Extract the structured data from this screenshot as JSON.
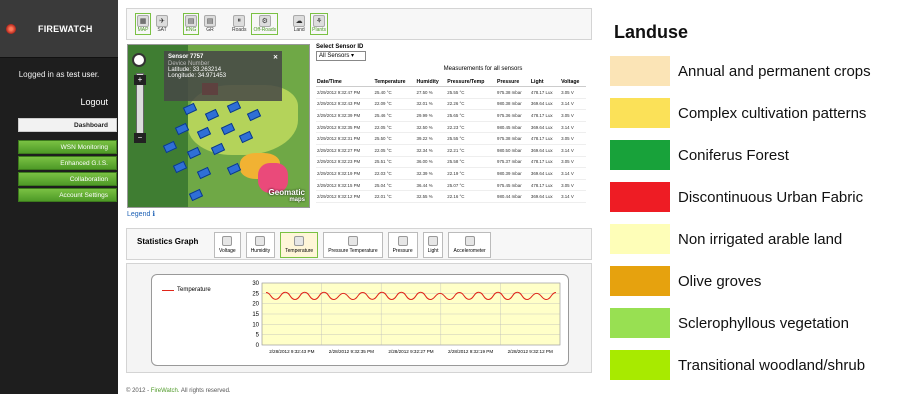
{
  "sidebar": {
    "brand": "FIREWATCH",
    "logged_in_prefix": "Logged in as",
    "logged_in_user": "test user.",
    "logout": "Logout",
    "menu": [
      "Dashboard",
      "WSN Monitoring",
      "Enhanced G.I.S.",
      "Collaboration",
      "Account Settings"
    ]
  },
  "toolbar": {
    "groups": [
      {
        "items": [
          "MAP",
          "SAT"
        ]
      },
      {
        "items": [
          "ENG",
          "GR"
        ]
      },
      {
        "items": [
          "Roads",
          "Off-Roads"
        ]
      },
      {
        "items": [
          "Land",
          "Plants"
        ]
      }
    ]
  },
  "map": {
    "popup_title": "Sensor 7757",
    "popup_sub": "Device Number",
    "popup_lat": "Latitude: 33.263214",
    "popup_lon": "Longitude: 34.971453",
    "watermark": "Geomatic",
    "watermark_sub": "maps"
  },
  "legend_link": "Legend",
  "sensor_select": {
    "label": "Select Sensor ID",
    "value": "All Sensors"
  },
  "measurements": {
    "title": "Measurements for all sensors",
    "columns": [
      "Date/Time",
      "Temperature",
      "Humidity",
      "Pressure/Temp",
      "Pressure",
      "Light",
      "Voltage"
    ],
    "rows": [
      [
        "2/29/2012 9:32:47 PM",
        "25.40 °C",
        "27.50 %",
        "25.55 °C",
        "975.38 mbar",
        "478.17 Lux",
        "3.05 V"
      ],
      [
        "2/29/2012 9:32:43 PM",
        "22.09 °C",
        "32.01 %",
        "22.26 °C",
        "980.38 mbar",
        "369.64 Lux",
        "3.14 V"
      ],
      [
        "2/29/2012 9:32:39 PM",
        "25.46 °C",
        "29.99 %",
        "25.65 °C",
        "975.36 mbar",
        "478.17 Lux",
        "3.05 V"
      ],
      [
        "2/29/2012 9:32:35 PM",
        "22.05 °C",
        "32.50 %",
        "22.23 °C",
        "980.45 mbar",
        "369.64 Lux",
        "3.14 V"
      ],
      [
        "2/29/2012 9:32:31 PM",
        "25.50 °C",
        "39.22 %",
        "25.55 °C",
        "975.38 mbar",
        "478.17 Lux",
        "3.05 V"
      ],
      [
        "2/29/2012 9:32:27 PM",
        "22.05 °C",
        "32.34 %",
        "22.21 °C",
        "980.50 mbar",
        "369.64 Lux",
        "3.14 V"
      ],
      [
        "2/29/2012 9:32:23 PM",
        "25.51 °C",
        "36.00 %",
        "25.58 °C",
        "975.37 mbar",
        "478.17 Lux",
        "3.05 V"
      ],
      [
        "2/29/2012 9:32:19 PM",
        "22.03 °C",
        "32.39 %",
        "22.19 °C",
        "980.39 mbar",
        "369.64 Lux",
        "3.14 V"
      ],
      [
        "2/29/2012 9:32:15 PM",
        "25.04 °C",
        "36.44 %",
        "25.07 °C",
        "975.45 mbar",
        "478.17 Lux",
        "3.05 V"
      ],
      [
        "2/29/2012 9:32:12 PM",
        "22.01 °C",
        "32.55 %",
        "22.16 °C",
        "980.44 mbar",
        "369.64 Lux",
        "3.14 V"
      ]
    ]
  },
  "stats": {
    "title": "Statistics Graph",
    "buttons": [
      "Voltage",
      "Humidity",
      "Temperature",
      "Pressure Temperature",
      "Pressure",
      "Light",
      "Accelerometer"
    ],
    "active": "Temperature"
  },
  "chart_data": {
    "type": "line",
    "series": [
      {
        "name": "Temperature",
        "values": [
          25.4,
          22.1,
          25.5,
          22.0,
          25.5,
          22.0,
          25.5,
          22.0,
          25.0,
          22.0,
          25.4,
          22.1,
          25.5,
          22.0,
          25.5,
          22.0,
          25.5,
          22.0,
          25.0,
          22.0,
          25.4,
          22.1,
          25.5,
          22.0,
          25.5,
          22.0,
          25.5,
          22.0,
          25.0,
          22.0,
          25.4
        ]
      }
    ],
    "yticks": [
      0,
      5,
      10,
      15,
      20,
      25,
      30
    ],
    "ylim": [
      0,
      30
    ],
    "xticklabels": [
      "2/28/2012 9:32:43 PM",
      "2/28/2012 9:32:35 PM",
      "2/28/2012 9:32:27 PM",
      "2/28/2012 9:32:19 PM",
      "2/28/2012 9:32:12 PM"
    ],
    "colors": {
      "line": "#e0261a",
      "fill": "#ffffc8"
    }
  },
  "footer": {
    "prefix": "© 2012 -",
    "link": "FireWatch.",
    "suffix": "All rights reserved."
  },
  "landuse": {
    "title": "Landuse",
    "items": [
      {
        "label": "Annual and permanent crops",
        "color": "#fbe4b6"
      },
      {
        "label": "Complex cultivation patterns",
        "color": "#fbe158"
      },
      {
        "label": "Coniferus Forest",
        "color": "#18a23a"
      },
      {
        "label": "Discontinuous Urban Fabric",
        "color": "#ee1c24"
      },
      {
        "label": "Non irrigated arable land",
        "color": "#fefeb8"
      },
      {
        "label": "Olive groves",
        "color": "#e6a20e"
      },
      {
        "label": "Sclerophyllous vegetation",
        "color": "#98e052"
      },
      {
        "label": "Transitional woodland/shrub",
        "color": "#a8ea00"
      }
    ]
  }
}
